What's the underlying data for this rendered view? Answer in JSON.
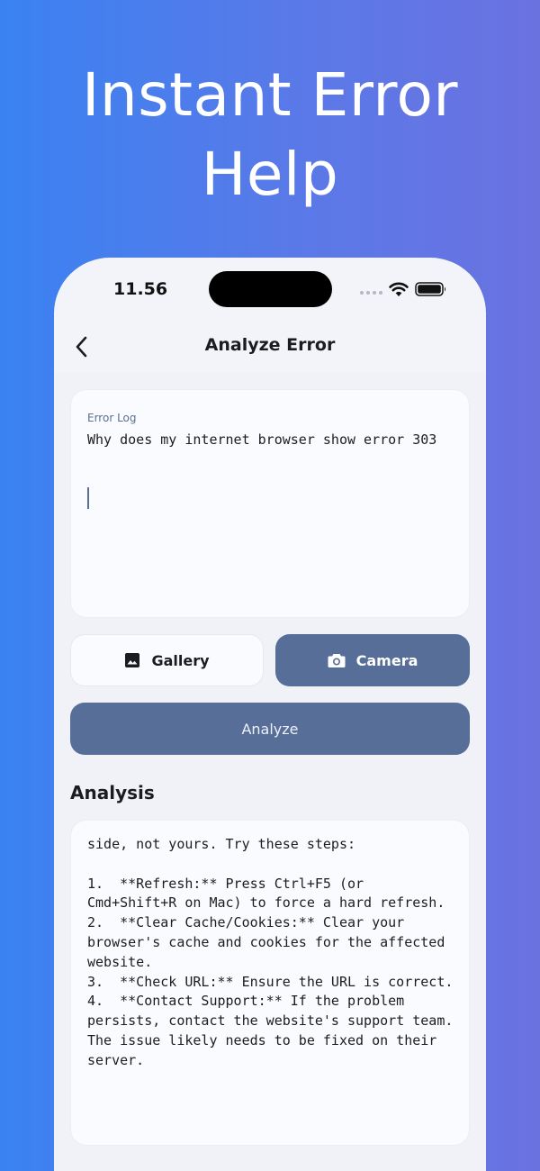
{
  "headline": {
    "line1": "Instant Error",
    "line2": "Help"
  },
  "status_bar": {
    "time": "11.56"
  },
  "nav": {
    "title": "Analyze Error"
  },
  "error_log": {
    "label": "Error Log",
    "value": "Why does my internet browser show error 303"
  },
  "buttons": {
    "gallery": "Gallery",
    "camera": "Camera",
    "analyze": "Analyze"
  },
  "analysis": {
    "title": "Analysis",
    "text": "side, not yours. Try these steps:\n\n1.  **Refresh:** Press Ctrl+F5 (or Cmd+Shift+R on Mac) to force a hard refresh.\n2.  **Clear Cache/Cookies:** Clear your browser's cache and cookies for the affected website.\n3.  **Check URL:** Ensure the URL is correct.\n4.  **Contact Support:** If the problem persists, contact the website's support team. The issue likely needs to be fixed on their server."
  },
  "icons": {
    "back": "chevron-left-icon",
    "gallery": "image-icon",
    "camera": "camera-icon",
    "wifi": "wifi-icon",
    "battery": "battery-icon",
    "signal": "signal-dots-icon"
  },
  "colors": {
    "accent": "#566e98",
    "background_gradient_start": "#3a82f2",
    "background_gradient_end": "#6a72e0"
  }
}
